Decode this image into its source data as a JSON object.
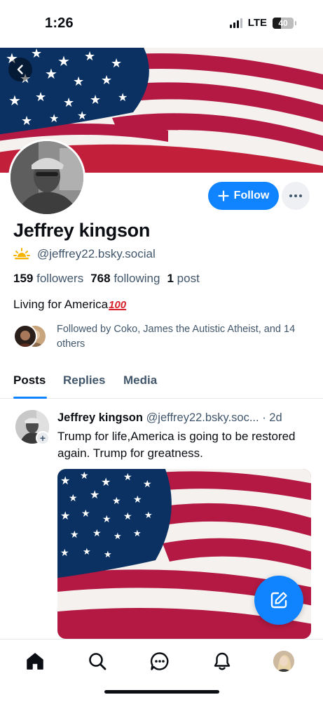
{
  "status_bar": {
    "time": "1:26",
    "network": "LTE",
    "battery": "40",
    "battery_level": 0.4
  },
  "profile": {
    "display_name": "Jeffrey kingson",
    "handle": "@jeffrey22.bsky.social",
    "followers_count": "159",
    "followers_label": "followers",
    "following_count": "768",
    "following_label": "following",
    "posts_count": "1",
    "posts_label": "post",
    "bio": "Living for America",
    "bio_emoji": "100",
    "followed_by_text": "Followed by Coko, James the Autistic Atheist, and 14 others"
  },
  "actions": {
    "follow_label": "Follow"
  },
  "tabs": [
    {
      "label": "Posts",
      "active": true
    },
    {
      "label": "Replies",
      "active": false
    },
    {
      "label": "Media",
      "active": false
    }
  ],
  "post": {
    "author": "Jeffrey kingson",
    "handle": "@jeffrey22.bsky.soc...",
    "time": "· 2d",
    "text": "Trump for life,America is going to be restored again. Trump for greatness."
  },
  "nav": {
    "items": [
      {
        "icon": "home-icon",
        "active": true
      },
      {
        "icon": "search-icon",
        "active": false
      },
      {
        "icon": "chat-icon",
        "active": false
      },
      {
        "icon": "bell-icon",
        "active": false
      },
      {
        "icon": "profile-avatar",
        "active": false
      }
    ]
  },
  "colors": {
    "accent": "#1083fe",
    "text_primary": "#0b0f14",
    "text_secondary": "#42576c",
    "flag_red": "#b31942",
    "flag_blue": "#0a3161"
  }
}
